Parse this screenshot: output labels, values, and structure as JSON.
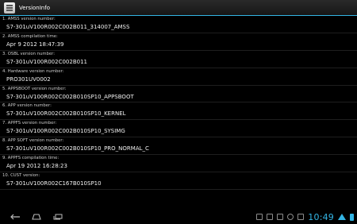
{
  "app": {
    "title": "VersionInfo",
    "icon": "document-icon"
  },
  "items": [
    {
      "label": "1. AMSS version number:",
      "value": "S7-301uV100R002C002B011_314007_AMSS"
    },
    {
      "label": "2. AMSS compilation time:",
      "value": "Apr  9 2012  18:47:39"
    },
    {
      "label": "3. OSBL version number:",
      "value": "S7-301uV100R002C002B011"
    },
    {
      "label": "4. Hardware version number:",
      "value": "PRO301UV0002"
    },
    {
      "label": "5. APPSBOOT version number:",
      "value": "S7-301uV100R002C002B010SP10_APPSBOOT"
    },
    {
      "label": "6. APP version number:",
      "value": "S7-301uV100R002C002B010SP10_KERNEL"
    },
    {
      "label": "7. APPFS version number:",
      "value": "S7-301uV100R002C002B010SP10_SYSIMG"
    },
    {
      "label": "8. APP SOFT version number:",
      "value": "S7-301uV100R002C002B010SP10_PRO_NORMAL_C"
    },
    {
      "label": "9. APPFS compilation time:",
      "value": "Apr 19 2012 16:28:23"
    },
    {
      "label": "10. CUST version:",
      "value": "S7-301uV100R002C167B010SP10"
    }
  ],
  "statusbar": {
    "time": "10:49"
  },
  "colors": {
    "accent": "#33b5e5",
    "background": "#000000"
  }
}
